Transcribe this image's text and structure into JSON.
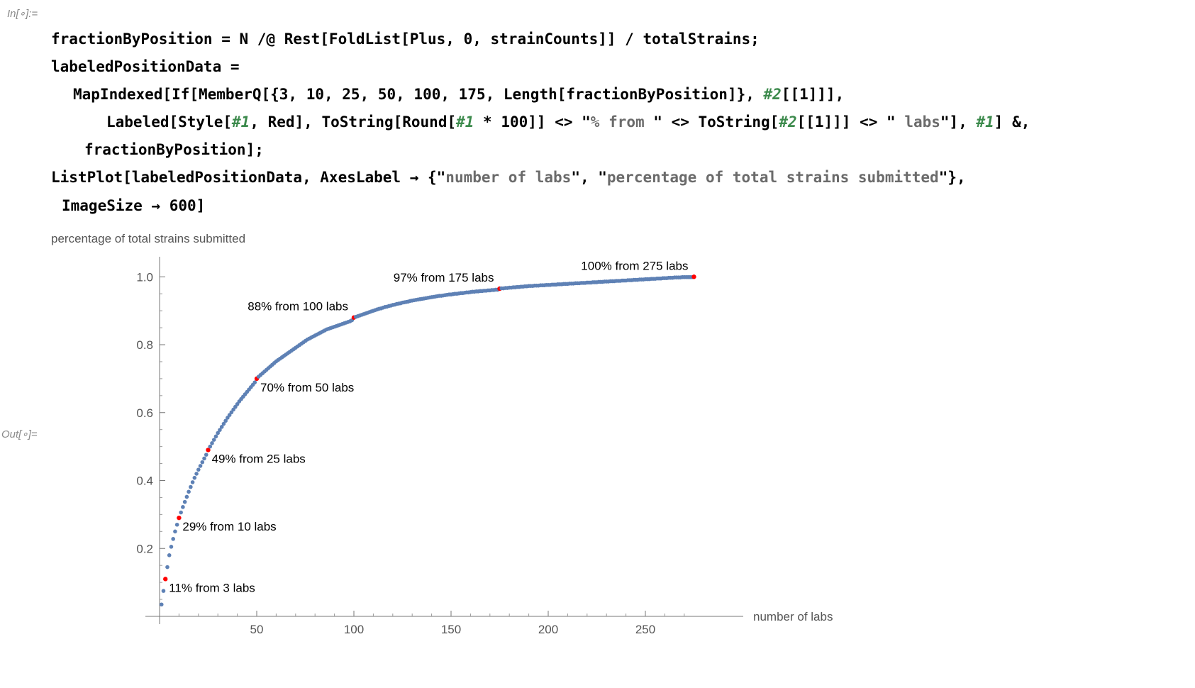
{
  "notebook": {
    "in_label": "In[∘]:=",
    "out_label": "Out[∘]=",
    "code_lines": [
      [
        {
          "t": "fractionByPosition = N /@ Rest[FoldList[Plus, 0, strainCounts]] / totalStrains;",
          "k": "plain"
        }
      ],
      [
        {
          "t": "labeledPositionData =",
          "k": "plain"
        }
      ],
      [
        {
          "t": "MapIndexed[If[MemberQ[{3, 10, 25, 50, 100, 175, Length[fractionByPosition]}, ",
          "k": "plain"
        },
        {
          "t": "#2",
          "k": "slot"
        },
        {
          "t": "[[1]]],",
          "k": "plain"
        }
      ],
      [
        {
          "t": "Labeled[Style[",
          "k": "plain"
        },
        {
          "t": "#1",
          "k": "slot"
        },
        {
          "t": ", Red], ToString[Round[",
          "k": "plain"
        },
        {
          "t": "#1",
          "k": "slot"
        },
        {
          "t": " * 100]] <> \"",
          "k": "plain"
        },
        {
          "t": "% from ",
          "k": "str"
        },
        {
          "t": "\" <> ToString[",
          "k": "plain"
        },
        {
          "t": "#2",
          "k": "slot"
        },
        {
          "t": "[[1]]] <> \"",
          "k": "plain"
        },
        {
          "t": " labs",
          "k": "str"
        },
        {
          "t": "\"], ",
          "k": "plain"
        },
        {
          "t": "#1",
          "k": "slot"
        },
        {
          "t": "] &,",
          "k": "plain"
        }
      ],
      [
        {
          "t": "fractionByPosition];",
          "k": "plain"
        }
      ],
      [
        {
          "t": "ListPlot[labeledPositionData, AxesLabel → {\"",
          "k": "plain"
        },
        {
          "t": "number of labs",
          "k": "str"
        },
        {
          "t": "\", \"",
          "k": "plain"
        },
        {
          "t": "percentage of total strains submitted",
          "k": "str"
        },
        {
          "t": "\"},",
          "k": "plain"
        }
      ],
      [
        {
          "t": "ImageSize → 600]",
          "k": "plain"
        }
      ]
    ]
  },
  "chart_data": {
    "type": "scatter",
    "xlabel": "number of labs",
    "ylabel": "percentage of total strains submitted",
    "xlim": [
      0,
      300
    ],
    "ylim": [
      0,
      1.05
    ],
    "x_ticks": [
      "50",
      "100",
      "150",
      "200",
      "250"
    ],
    "y_ticks": [
      "0.2",
      "0.4",
      "0.6",
      "0.8",
      "1.0"
    ],
    "grid": false,
    "point_color": "#5e81b5",
    "highlight_color": "#ff0000",
    "values": [
      0.035,
      0.075,
      0.11,
      0.145,
      0.18,
      0.205,
      0.228,
      0.25,
      0.27,
      0.29,
      0.306,
      0.322,
      0.337,
      0.352,
      0.367,
      0.381,
      0.395,
      0.408,
      0.42,
      0.432,
      0.443,
      0.454,
      0.465,
      0.476,
      0.49,
      0.5,
      0.51,
      0.52,
      0.53,
      0.54,
      0.549,
      0.558,
      0.567,
      0.576,
      0.585,
      0.593,
      0.601,
      0.609,
      0.617,
      0.625,
      0.633,
      0.64,
      0.647,
      0.654,
      0.661,
      0.668,
      0.675,
      0.682,
      0.689,
      0.7,
      0.706,
      0.711,
      0.716,
      0.721,
      0.726,
      0.731,
      0.736,
      0.741,
      0.746,
      0.751,
      0.755,
      0.759,
      0.763,
      0.767,
      0.771,
      0.775,
      0.779,
      0.783,
      0.787,
      0.791,
      0.795,
      0.799,
      0.803,
      0.807,
      0.811,
      0.815,
      0.818,
      0.821,
      0.824,
      0.827,
      0.83,
      0.833,
      0.836,
      0.839,
      0.842,
      0.845,
      0.847,
      0.849,
      0.851,
      0.853,
      0.855,
      0.857,
      0.859,
      0.861,
      0.863,
      0.865,
      0.867,
      0.869,
      0.872,
      0.88,
      0.882,
      0.884,
      0.886,
      0.888,
      0.89,
      0.892,
      0.894,
      0.896,
      0.898,
      0.9,
      0.902,
      0.904,
      0.906,
      0.907,
      0.909,
      0.911,
      0.912,
      0.914,
      0.915,
      0.917,
      0.918,
      0.92,
      0.921,
      0.922,
      0.924,
      0.925,
      0.926,
      0.927,
      0.929,
      0.93,
      0.931,
      0.932,
      0.933,
      0.934,
      0.935,
      0.936,
      0.937,
      0.938,
      0.939,
      0.94,
      0.941,
      0.942,
      0.943,
      0.944,
      0.944,
      0.945,
      0.946,
      0.947,
      0.948,
      0.948,
      0.949,
      0.95,
      0.95,
      0.951,
      0.952,
      0.952,
      0.953,
      0.954,
      0.954,
      0.955,
      0.956,
      0.956,
      0.957,
      0.957,
      0.958,
      0.958,
      0.959,
      0.959,
      0.96,
      0.96,
      0.961,
      0.961,
      0.962,
      0.962,
      0.965,
      0.966,
      0.966,
      0.967,
      0.967,
      0.968,
      0.968,
      0.969,
      0.969,
      0.97,
      0.97,
      0.971,
      0.971,
      0.972,
      0.972,
      0.973,
      0.973,
      0.973,
      0.974,
      0.974,
      0.974,
      0.975,
      0.975,
      0.975,
      0.976,
      0.976,
      0.976,
      0.977,
      0.977,
      0.977,
      0.978,
      0.978,
      0.978,
      0.979,
      0.979,
      0.979,
      0.98,
      0.98,
      0.98,
      0.981,
      0.981,
      0.981,
      0.982,
      0.982,
      0.982,
      0.983,
      0.983,
      0.983,
      0.984,
      0.984,
      0.984,
      0.985,
      0.985,
      0.985,
      0.986,
      0.986,
      0.986,
      0.987,
      0.987,
      0.987,
      0.988,
      0.988,
      0.988,
      0.989,
      0.989,
      0.989,
      0.99,
      0.99,
      0.99,
      0.991,
      0.991,
      0.991,
      0.992,
      0.992,
      0.992,
      0.993,
      0.993,
      0.993,
      0.994,
      0.994,
      0.994,
      0.995,
      0.995,
      0.995,
      0.996,
      0.996,
      0.996,
      0.997,
      0.997,
      0.997,
      0.998,
      0.998,
      0.998,
      0.998,
      0.999,
      0.999,
      0.999,
      0.999,
      0.999,
      0.999,
      1.0
    ],
    "labeled_points": [
      {
        "x": 3,
        "text": "11% from 3 labs",
        "side": "below-right"
      },
      {
        "x": 10,
        "text": "29% from 10 labs",
        "side": "below-right"
      },
      {
        "x": 25,
        "text": "49% from 25 labs",
        "side": "below-right"
      },
      {
        "x": 50,
        "text": "70% from 50 labs",
        "side": "below-right"
      },
      {
        "x": 100,
        "text": "88% from 100 labs",
        "side": "above-left"
      },
      {
        "x": 175,
        "text": "97% from 175 labs",
        "side": "above-left"
      },
      {
        "x": 275,
        "text": "100% from 275 labs",
        "side": "above-left"
      }
    ]
  }
}
